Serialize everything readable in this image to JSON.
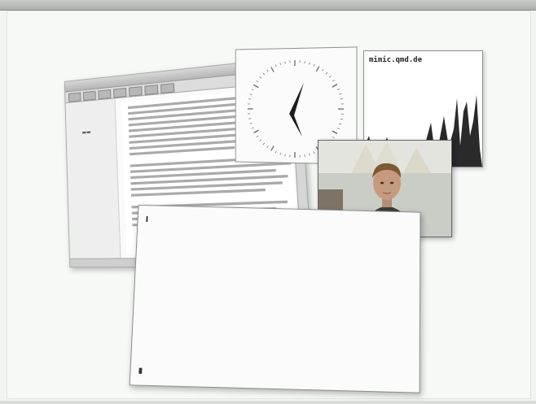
{
  "window": {
    "title": ""
  },
  "meter": {
    "hostname": "mimic.qmd.de"
  },
  "terminal": {
    "prompt_top": "",
    "prompt_bottom": "",
    "rows": [
      {
        "perm": "",
        "user": "",
        "group": "",
        "size": "",
        "date": "",
        "name": "",
        "color": "green"
      },
      {
        "perm": "",
        "user": "",
        "group": "",
        "size": "",
        "date": "",
        "name": "",
        "color": "blue"
      },
      {
        "perm": "",
        "user": "",
        "group": "",
        "size": "",
        "date": "",
        "name": "",
        "color": "green"
      },
      {
        "perm": "",
        "user": "",
        "group": "",
        "size": "",
        "date": "",
        "name": "",
        "color": "green"
      },
      {
        "perm": "",
        "user": "",
        "group": "",
        "size": "",
        "date": "",
        "name": "",
        "color": "blue"
      },
      {
        "perm": "",
        "user": "",
        "group": "",
        "size": "",
        "date": "",
        "name": "",
        "color": "green"
      },
      {
        "perm": "",
        "user": "",
        "group": "",
        "size": "",
        "date": "",
        "name": "",
        "color": "green"
      },
      {
        "perm": "",
        "user": "",
        "group": "",
        "size": "",
        "date": "",
        "name": "",
        "color": "blue"
      },
      {
        "perm": "",
        "user": "",
        "group": "",
        "size": "",
        "date": "",
        "name": "",
        "color": "blue"
      },
      {
        "perm": "",
        "user": "",
        "group": "",
        "size": "",
        "date": "",
        "name": "",
        "color": "blue"
      },
      {
        "perm": "",
        "user": "",
        "group": "",
        "size": "",
        "date": "",
        "name": "",
        "color": "blue"
      },
      {
        "perm": "",
        "user": "",
        "group": "",
        "size": "",
        "date": "",
        "name": "",
        "color": "blue"
      },
      {
        "perm": "",
        "user": "",
        "group": "",
        "size": "",
        "date": "",
        "name": "",
        "color": "blue"
      },
      {
        "perm": "",
        "user": "",
        "group": "",
        "size": "",
        "date": "",
        "name": "",
        "color": "blue"
      },
      {
        "perm": "",
        "user": "",
        "group": "",
        "size": "",
        "date": "",
        "name": "",
        "color": "blue"
      },
      {
        "perm": "",
        "user": "",
        "group": "",
        "size": "",
        "date": "",
        "name": "",
        "color": "blue"
      }
    ]
  },
  "colors": {
    "term_dir": "#3b5bd6",
    "term_exec": "#2e9a3a",
    "meter_fill": "#2a2a2a",
    "clock_hand": "#1c1c1c"
  }
}
